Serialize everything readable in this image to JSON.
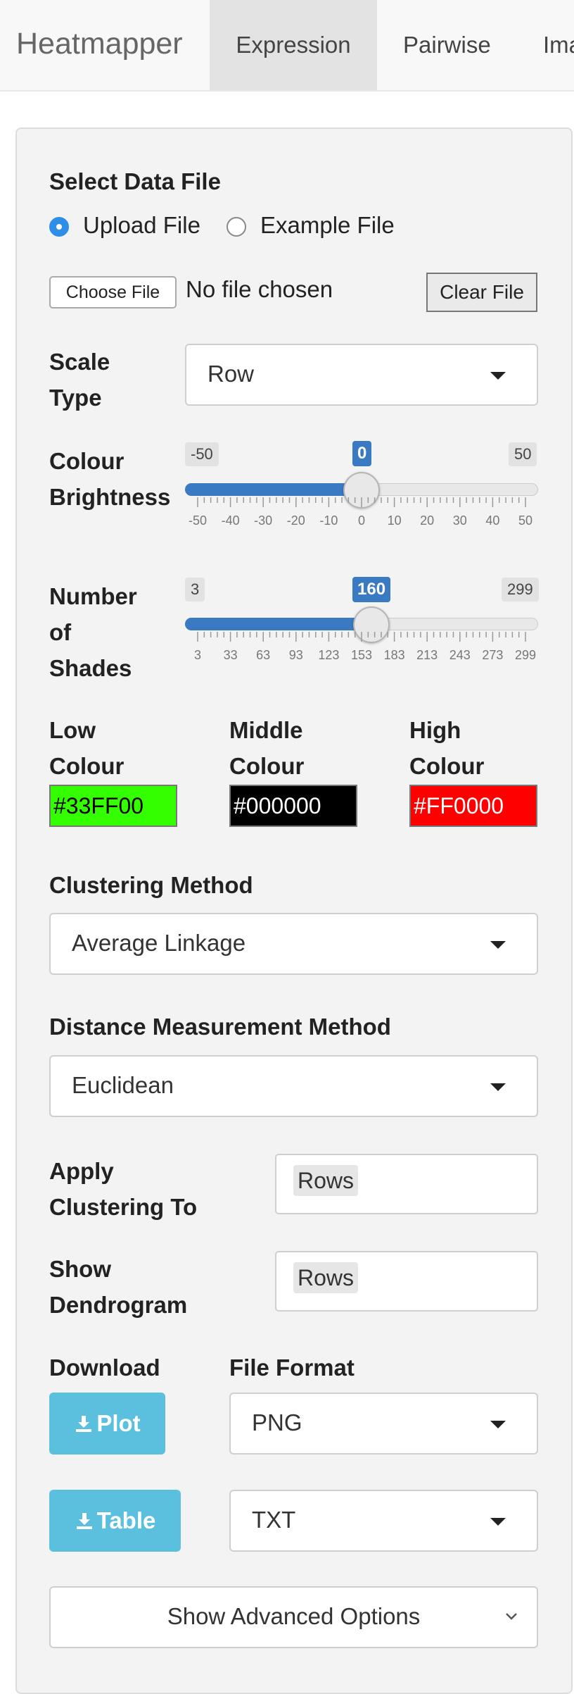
{
  "navbar": {
    "brand": "Heatmapper",
    "tabs": [
      {
        "label": "Expression",
        "active": true
      },
      {
        "label": "Pairwise",
        "active": false
      },
      {
        "label": "Ima",
        "active": false
      }
    ]
  },
  "data_file": {
    "title": "Select Data File",
    "options": [
      {
        "label": "Upload File",
        "selected": true
      },
      {
        "label": "Example File",
        "selected": false
      }
    ],
    "choose_label": "Choose File",
    "no_file": "No file chosen",
    "clear_label": "Clear File"
  },
  "scale_type": {
    "label_l1": "Scale",
    "label_l2": "Type",
    "value": "Row"
  },
  "brightness": {
    "label_l1": "Colour",
    "label_l2": "Brightness",
    "min": "-50",
    "max": "50",
    "value": "0",
    "fraction": 0.5,
    "ticks": [
      "-50",
      "-40",
      "-30",
      "-20",
      "-10",
      "0",
      "10",
      "20",
      "30",
      "40",
      "50"
    ]
  },
  "shades": {
    "label_l1": "Number",
    "label_l2": "of",
    "label_l3": "Shades",
    "min": "3",
    "max": "299",
    "value": "160",
    "fraction": 0.53,
    "ticks": [
      "3",
      "33",
      "63",
      "93",
      "123",
      "153",
      "183",
      "213",
      "243",
      "273",
      "299"
    ]
  },
  "colours": {
    "low": {
      "label_l1": "Low",
      "label_l2": "Colour",
      "value": "#33FF00",
      "bg": "#33FF00",
      "fg": "#000000"
    },
    "mid": {
      "label_l1": "Middle",
      "label_l2": "Colour",
      "value": "#000000",
      "bg": "#000000",
      "fg": "#ffffff"
    },
    "high": {
      "label_l1": "High",
      "label_l2": "Colour",
      "value": "#FF0000",
      "bg": "#FF0000",
      "fg": "#ffffff"
    }
  },
  "clustering": {
    "label": "Clustering Method",
    "value": "Average Linkage"
  },
  "distance": {
    "label": "Distance Measurement Method",
    "value": "Euclidean"
  },
  "apply_to": {
    "label_l1": "Apply",
    "label_l2": "Clustering To",
    "value": "Rows"
  },
  "dendrogram": {
    "label_l1": "Show",
    "label_l2": "Dendrogram",
    "value": "Rows"
  },
  "download": {
    "label": "Download",
    "format_label": "File Format",
    "plot_button": "Plot",
    "table_button": "Table",
    "plot_format": "PNG",
    "table_format": "TXT"
  },
  "advanced": {
    "label": "Show Advanced Options"
  },
  "accent": {
    "slider": "#3a7ac3",
    "radio": "#2f8ee8",
    "download": "#5bc0de"
  }
}
